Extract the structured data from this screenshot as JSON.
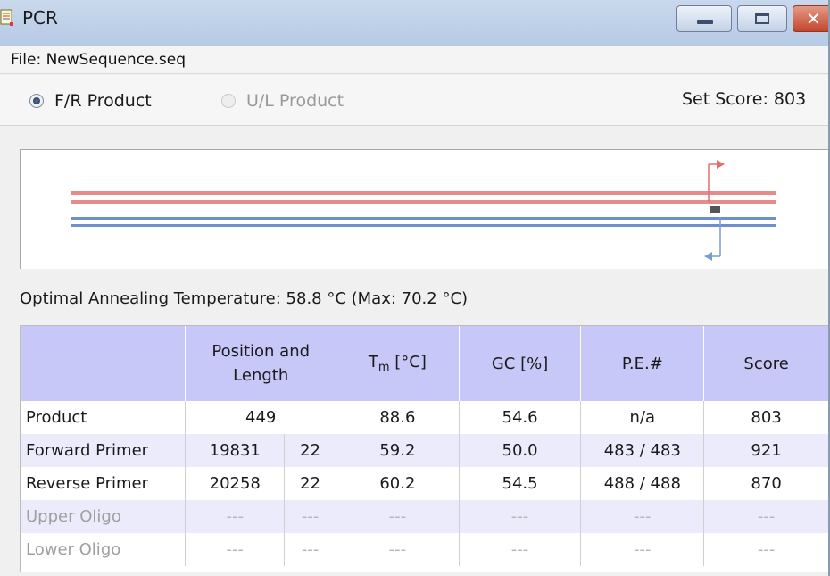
{
  "window": {
    "title": "PCR"
  },
  "file": {
    "label": "File: NewSequence.seq"
  },
  "product_mode": {
    "options": [
      {
        "label": "F/R Product",
        "selected": true,
        "enabled": true
      },
      {
        "label": "U/L Product",
        "selected": false,
        "enabled": false
      }
    ]
  },
  "set_score": "Set Score: 803",
  "diagram": {
    "forward_strand_color": "#e07070",
    "reverse_strand_color": "#5a84c9"
  },
  "optimal_annealing": "Optimal Annealing Temperature: 58.8 °C (Max: 70.2 °C)",
  "table": {
    "headers": {
      "position_line1": "Position and",
      "position_line2": "Length",
      "tm_main": "T",
      "tm_sub": "m",
      "tm_unit": " [°C]",
      "gc": "GC [%]",
      "pe": "P.E.#",
      "score": "Score"
    },
    "rows": [
      {
        "label": "Product",
        "position": "449",
        "length": "",
        "tm": "88.6",
        "gc": "54.6",
        "pe": "n/a",
        "score": "803"
      },
      {
        "label": "Forward Primer",
        "position": "19831",
        "length": "22",
        "tm": "59.2",
        "gc": "50.0",
        "pe": "483 / 483",
        "score": "921"
      },
      {
        "label": "Reverse Primer",
        "position": "20258",
        "length": "22",
        "tm": "60.2",
        "gc": "54.5",
        "pe": "488 / 488",
        "score": "870"
      },
      {
        "label": "Upper Oligo",
        "position": "---",
        "length": "---",
        "tm": "---",
        "gc": "---",
        "pe": "---",
        "score": "---"
      },
      {
        "label": "Lower Oligo",
        "position": "---",
        "length": "---",
        "tm": "---",
        "gc": "---",
        "pe": "---",
        "score": "---"
      }
    ]
  }
}
